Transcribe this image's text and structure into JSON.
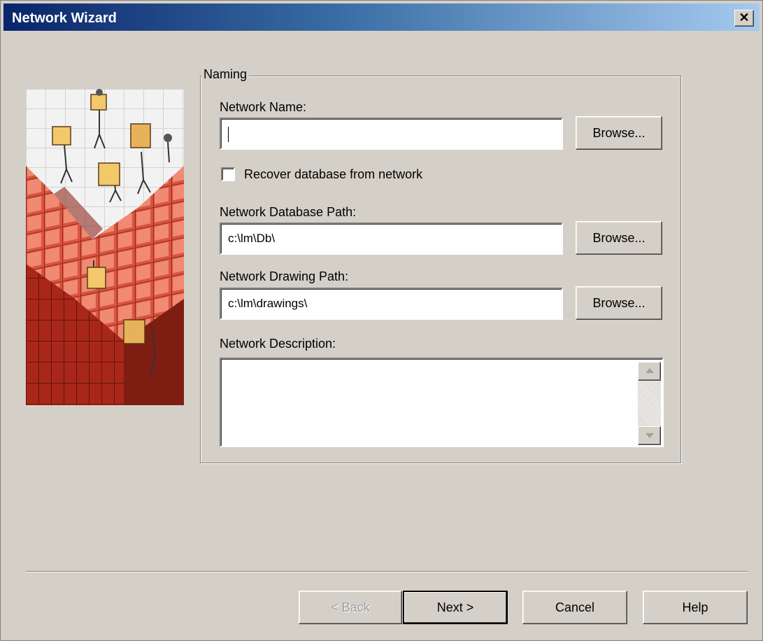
{
  "window": {
    "title": "Network Wizard",
    "close_label": "✕"
  },
  "group": {
    "legend": "Naming"
  },
  "fields": {
    "network_name": {
      "label": "Network Name:",
      "value": "",
      "browse_label": "Browse..."
    },
    "recover_checkbox": {
      "label": "Recover database from network",
      "checked": false
    },
    "database_path": {
      "label": "Network Database Path:",
      "value": "c:\\lm\\Db\\",
      "browse_label": "Browse..."
    },
    "drawing_path": {
      "label": "Network Drawing Path:",
      "value": "c:\\lm\\drawings\\",
      "browse_label": "Browse..."
    },
    "description": {
      "label": "Network Description:",
      "value": ""
    }
  },
  "footer": {
    "back_label": "< Back",
    "next_label": "Next >",
    "cancel_label": "Cancel",
    "help_label": "Help"
  },
  "icons": {
    "close": "close-icon",
    "scroll_up": "scroll-up-arrow-icon",
    "scroll_down": "scroll-down-arrow-icon",
    "wizard_image": "wizard-illustration"
  },
  "colors": {
    "titlebar_start": "#0a246a",
    "titlebar_end": "#a6caf0",
    "window_bg": "#d4d0c8"
  }
}
